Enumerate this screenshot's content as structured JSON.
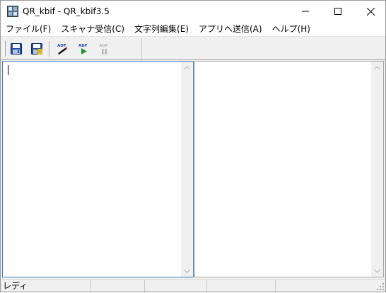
{
  "window": {
    "title": "QR_kbif - QR_kbif3.5",
    "icon": "app-icon"
  },
  "caption_buttons": [
    "minimize-icon",
    "maximize-icon",
    "close-icon"
  ],
  "menu": [
    {
      "label": "ファイル(F)"
    },
    {
      "label": "スキャナ受信(C)"
    },
    {
      "label": "文字列編集(E)"
    },
    {
      "label": "アプリへ送信(A)"
    },
    {
      "label": "ヘルプ(H)"
    }
  ],
  "toolbar": {
    "buttons": [
      {
        "icon": "save-icon",
        "enabled": true
      },
      {
        "icon": "save-as-icon",
        "enabled": true
      },
      {
        "icon": "adf-edit-icon",
        "enabled": true
      },
      {
        "icon": "adf-start-icon",
        "enabled": true
      },
      {
        "icon": "adf-pause-icon",
        "enabled": false
      }
    ],
    "adf_label": "ADF"
  },
  "left_pane": {
    "text": ""
  },
  "right_pane": {
    "text": ""
  },
  "status": {
    "panels": [
      "レディ",
      "",
      "",
      "",
      ""
    ]
  },
  "colors": {
    "focus_border": "#3d7bbf",
    "chrome": "#f0f0f0"
  }
}
